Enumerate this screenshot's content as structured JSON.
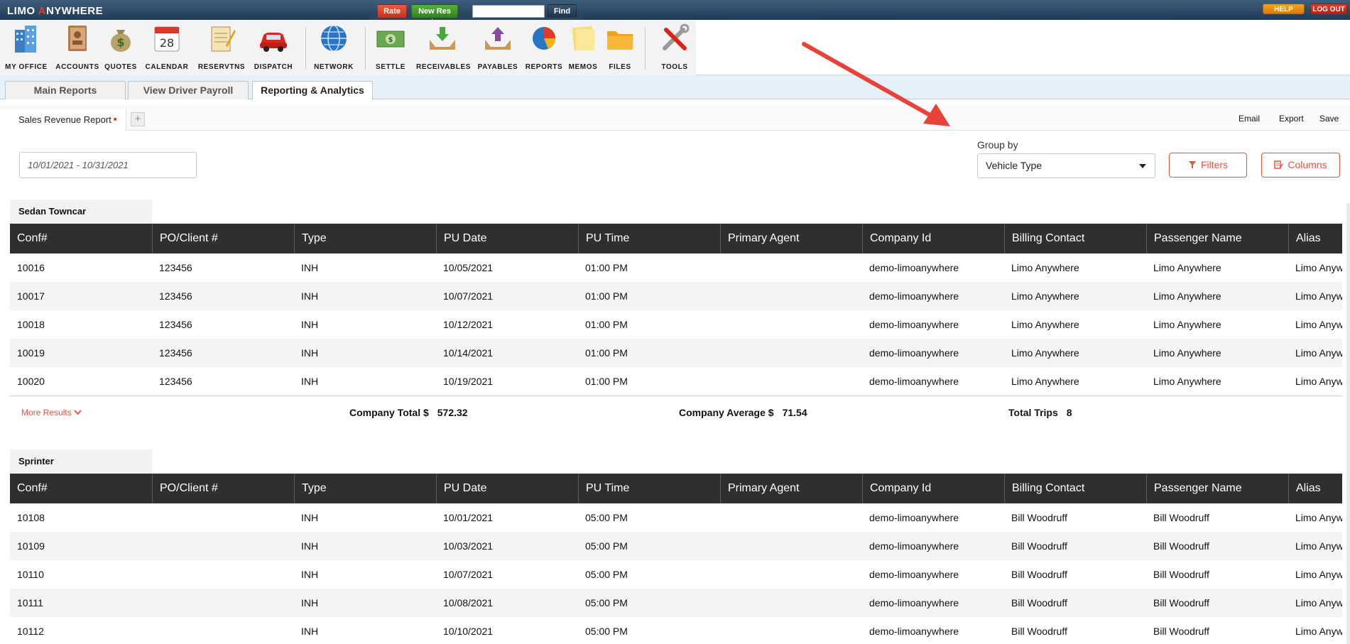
{
  "topbar": {
    "logo_left": "LIMO ",
    "logo_star": "A",
    "logo_right": "NYWHERE",
    "rate_label": "Rate",
    "newres_label": "New Res",
    "find_label": "Find",
    "search_value": "",
    "help_label": "HELP",
    "logout_label": "LOG OUT"
  },
  "toolbar": {
    "items": [
      {
        "label": "MY OFFICE",
        "icon": "building-icon"
      },
      {
        "label": "ACCOUNTS",
        "icon": "address-book-icon"
      },
      {
        "label": "QUOTES",
        "icon": "money-bag-icon"
      },
      {
        "label": "CALENDAR",
        "icon": "calendar-icon",
        "day": "28"
      },
      {
        "label": "RESERVTNS",
        "icon": "notepad-icon"
      },
      {
        "label": "DISPATCH",
        "icon": "car-icon"
      },
      {
        "label": "NETWORK",
        "icon": "globe-icon"
      },
      {
        "label": "SETTLE",
        "icon": "cash-icon"
      },
      {
        "label": "RECEIVABLES",
        "icon": "inbox-icon"
      },
      {
        "label": "PAYABLES",
        "icon": "outbox-icon"
      },
      {
        "label": "REPORTS",
        "icon": "pie-chart-icon"
      },
      {
        "label": "MEMOS",
        "icon": "sticky-note-icon"
      },
      {
        "label": "FILES",
        "icon": "folder-icon"
      },
      {
        "label": "TOOLS",
        "icon": "tools-icon"
      }
    ]
  },
  "tabs": [
    {
      "label": "Main Reports"
    },
    {
      "label": "View Driver Payroll"
    },
    {
      "label": "Reporting & Analytics"
    }
  ],
  "report_tabs": {
    "current": "Sales Revenue Report",
    "add": "+",
    "email": "Email",
    "export": "Export",
    "save": "Save"
  },
  "controls": {
    "date_range": "10/01/2021 - 10/31/2021",
    "group_by_label": "Group by",
    "group_by_value": "Vehicle Type",
    "filters_label": "Filters",
    "columns_label": "Columns"
  },
  "columns": [
    "Conf#",
    "PO/Client #",
    "Type",
    "PU Date",
    "PU Time",
    "Primary Agent",
    "Company Id",
    "Billing Contact",
    "Passenger Name",
    "Alias"
  ],
  "groups": [
    {
      "name": "Sedan Towncar",
      "rows": [
        [
          "10016",
          "123456",
          "INH",
          "10/05/2021",
          "01:00 PM",
          "",
          "demo-limoanywhere",
          "Limo Anywhere",
          "Limo Anywhere",
          "Limo Anywhere"
        ],
        [
          "10017",
          "123456",
          "INH",
          "10/07/2021",
          "01:00 PM",
          "",
          "demo-limoanywhere",
          "Limo Anywhere",
          "Limo Anywhere",
          "Limo Anywhere"
        ],
        [
          "10018",
          "123456",
          "INH",
          "10/12/2021",
          "01:00 PM",
          "",
          "demo-limoanywhere",
          "Limo Anywhere",
          "Limo Anywhere",
          "Limo Anywhere"
        ],
        [
          "10019",
          "123456",
          "INH",
          "10/14/2021",
          "01:00 PM",
          "",
          "demo-limoanywhere",
          "Limo Anywhere",
          "Limo Anywhere",
          "Limo Anywhere"
        ],
        [
          "10020",
          "123456",
          "INH",
          "10/19/2021",
          "01:00 PM",
          "",
          "demo-limoanywhere",
          "Limo Anywhere",
          "Limo Anywhere",
          "Limo Anywhere"
        ]
      ],
      "more_results": "More Results",
      "company_total_label": "Company Total $",
      "company_total": "572.32",
      "company_average_label": "Company Average $",
      "company_average": "71.54",
      "total_trips_label": "Total Trips",
      "total_trips": "8"
    },
    {
      "name": "Sprinter",
      "rows": [
        [
          "10108",
          "",
          "INH",
          "10/01/2021",
          "05:00 PM",
          "",
          "demo-limoanywhere",
          "Bill Woodruff",
          "Bill Woodruff",
          "Limo Anywhere"
        ],
        [
          "10109",
          "",
          "INH",
          "10/03/2021",
          "05:00 PM",
          "",
          "demo-limoanywhere",
          "Bill Woodruff",
          "Bill Woodruff",
          "Limo Anywhere"
        ],
        [
          "10110",
          "",
          "INH",
          "10/07/2021",
          "05:00 PM",
          "",
          "demo-limoanywhere",
          "Bill Woodruff",
          "Bill Woodruff",
          "Limo Anywhere"
        ],
        [
          "10111",
          "",
          "INH",
          "10/08/2021",
          "05:00 PM",
          "",
          "demo-limoanywhere",
          "Bill Woodruff",
          "Bill Woodruff",
          "Limo Anywhere"
        ],
        [
          "10112",
          "",
          "INH",
          "10/10/2021",
          "05:00 PM",
          "",
          "demo-limoanywhere",
          "Bill Woodruff",
          "Bill Woodruff",
          "Limo Anywhere"
        ]
      ]
    }
  ],
  "colors": {
    "accent": "#e5533f",
    "header_bg": "#2f2f2f",
    "arrow": "#e8423a"
  }
}
